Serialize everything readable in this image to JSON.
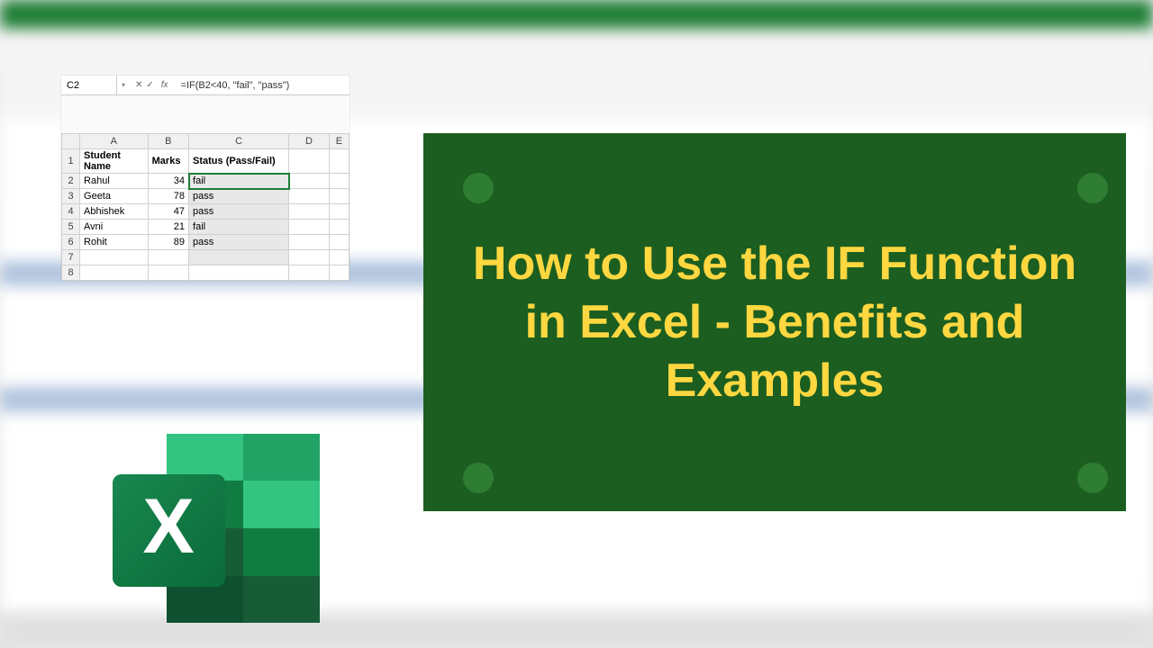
{
  "formula_bar": {
    "cell_ref": "C2",
    "fx_label": "fx",
    "formula": "=IF(B2<40, \"fail\", \"pass\")"
  },
  "grid": {
    "col_headers": [
      "A",
      "B",
      "C",
      "D",
      "E"
    ],
    "header_row": [
      "Student Name",
      "Marks",
      "Status (Pass/Fail)"
    ],
    "rows": [
      {
        "num": 2,
        "name": "Rahul",
        "marks": 34,
        "status": "fail"
      },
      {
        "num": 3,
        "name": "Geeta",
        "marks": 78,
        "status": "pass"
      },
      {
        "num": 4,
        "name": "Abhishek",
        "marks": 47,
        "status": "pass"
      },
      {
        "num": 5,
        "name": "Avni",
        "marks": 21,
        "status": "fail"
      },
      {
        "num": 6,
        "name": "Rohit",
        "marks": 89,
        "status": "pass"
      }
    ],
    "empty_rows": [
      7,
      8
    ]
  },
  "title_card": {
    "text": "How to Use the IF Function in Excel - Benefits and Examples"
  },
  "logo": {
    "letter": "X"
  }
}
